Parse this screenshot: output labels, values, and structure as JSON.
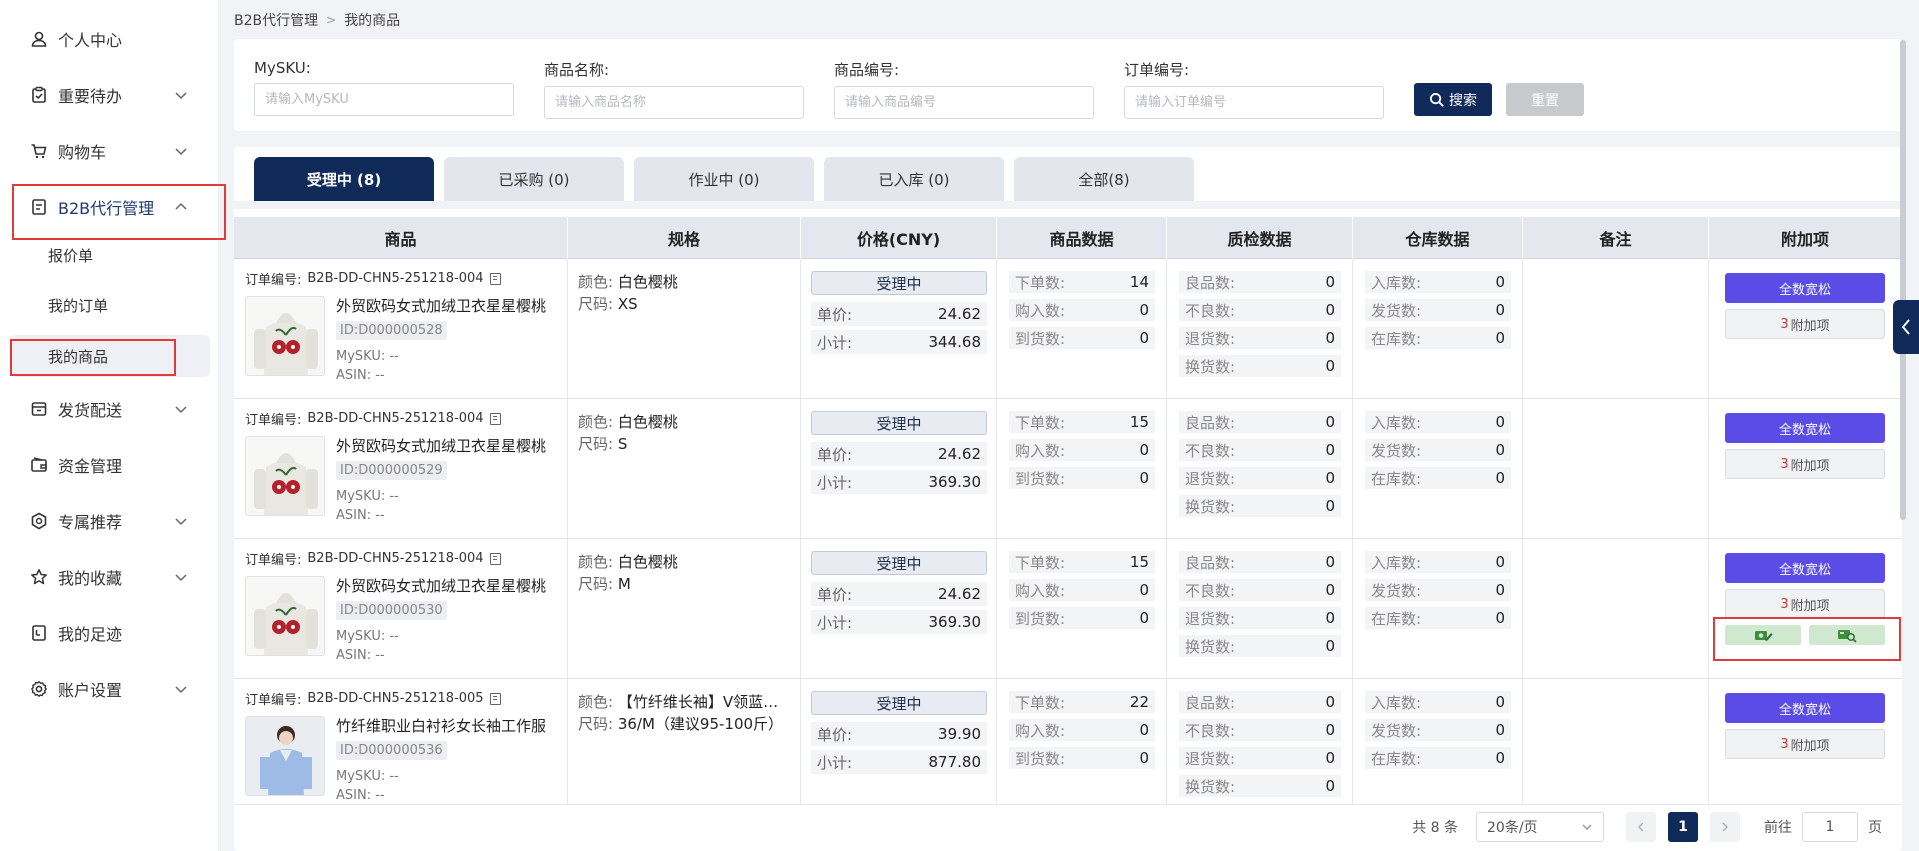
{
  "sidebar": {
    "items": [
      {
        "label": "个人中心",
        "icon": "user-icon",
        "has_chevron": false
      },
      {
        "label": "重要待办",
        "icon": "clipboard-icon",
        "has_chevron": true
      },
      {
        "label": "购物车",
        "icon": "cart-icon",
        "has_chevron": true
      },
      {
        "label": "B2B代行管理",
        "icon": "document-icon",
        "has_chevron": true,
        "expanded": true
      },
      {
        "label": "发货配送",
        "icon": "box-icon",
        "has_chevron": true
      },
      {
        "label": "资金管理",
        "icon": "wallet-icon",
        "has_chevron": false
      },
      {
        "label": "专属推荐",
        "icon": "badge-icon",
        "has_chevron": true
      },
      {
        "label": "我的收藏",
        "icon": "star-icon",
        "has_chevron": true
      },
      {
        "label": "我的足迹",
        "icon": "history-icon",
        "has_chevron": false
      },
      {
        "label": "账户设置",
        "icon": "gear-icon",
        "has_chevron": true
      }
    ],
    "subitems": [
      "报价单",
      "我的订单",
      "我的商品"
    ],
    "selected_subitem": "我的商品"
  },
  "breadcrumb": {
    "parent": "B2B代行管理",
    "current": "我的商品"
  },
  "filters": {
    "sku": {
      "label": "MySKU:",
      "placeholder": "请输入MySKU"
    },
    "name": {
      "label": "商品名称:",
      "placeholder": "请输入商品名称"
    },
    "code": {
      "label": "商品编号:",
      "placeholder": "请输入商品编号"
    },
    "order": {
      "label": "订单编号:",
      "placeholder": "请输入订单编号"
    },
    "search_label": "搜索",
    "reset_label": "重置"
  },
  "tabs": [
    "受理中 (8)",
    "已采购 (0)",
    "作业中 (0)",
    "已入库 (0)",
    "全部(8)"
  ],
  "table": {
    "headers": [
      "商品",
      "规格",
      "价格(CNY)",
      "商品数据",
      "质检数据",
      "仓库数据",
      "备注",
      "附加项"
    ],
    "rows": [
      {
        "order_label": "订单编号:",
        "order_no": "B2B-DD-CHN5-251218-004",
        "name": "外贸欧码女式加绒卫衣星星樱桃",
        "id": "ID:D000000528",
        "mysku": "MySKU: --",
        "asin": "ASIN: --",
        "color_k": "颜色:",
        "color_v": "白色樱桃",
        "size_k": "尺码:",
        "size_v": "XS",
        "status": "受理中",
        "unit_k": "单价:",
        "unit_v": "24.62",
        "sub_k": "小计:",
        "sub_v": "344.68",
        "gd": [
          [
            "下单数:",
            "14"
          ],
          [
            "购入数:",
            "0"
          ],
          [
            "到货数:",
            "0"
          ]
        ],
        "qc": [
          [
            "良品数:",
            "0"
          ],
          [
            "不良数:",
            "0"
          ],
          [
            "退货数:",
            "0"
          ],
          [
            "换货数:",
            "0"
          ]
        ],
        "wh": [
          [
            "入库数:",
            "0"
          ],
          [
            "发货数:",
            "0"
          ],
          [
            "在库数:",
            "0"
          ]
        ],
        "btn": "全数宽松",
        "extra_n": "3",
        "extra_t": "附加项",
        "thumb": "hoodie"
      },
      {
        "order_label": "订单编号:",
        "order_no": "B2B-DD-CHN5-251218-004",
        "name": "外贸欧码女式加绒卫衣星星樱桃",
        "id": "ID:D000000529",
        "mysku": "MySKU: --",
        "asin": "ASIN: --",
        "color_k": "颜色:",
        "color_v": "白色樱桃",
        "size_k": "尺码:",
        "size_v": "S",
        "status": "受理中",
        "unit_k": "单价:",
        "unit_v": "24.62",
        "sub_k": "小计:",
        "sub_v": "369.30",
        "gd": [
          [
            "下单数:",
            "15"
          ],
          [
            "购入数:",
            "0"
          ],
          [
            "到货数:",
            "0"
          ]
        ],
        "qc": [
          [
            "良品数:",
            "0"
          ],
          [
            "不良数:",
            "0"
          ],
          [
            "退货数:",
            "0"
          ],
          [
            "换货数:",
            "0"
          ]
        ],
        "wh": [
          [
            "入库数:",
            "0"
          ],
          [
            "发货数:",
            "0"
          ],
          [
            "在库数:",
            "0"
          ]
        ],
        "btn": "全数宽松",
        "extra_n": "3",
        "extra_t": "附加项",
        "thumb": "hoodie"
      },
      {
        "order_label": "订单编号:",
        "order_no": "B2B-DD-CHN5-251218-004",
        "name": "外贸欧码女式加绒卫衣星星樱桃",
        "id": "ID:D000000530",
        "mysku": "MySKU: --",
        "asin": "ASIN: --",
        "color_k": "颜色:",
        "color_v": "白色樱桃",
        "size_k": "尺码:",
        "size_v": "M",
        "status": "受理中",
        "unit_k": "单价:",
        "unit_v": "24.62",
        "sub_k": "小计:",
        "sub_v": "369.30",
        "gd": [
          [
            "下单数:",
            "15"
          ],
          [
            "购入数:",
            "0"
          ],
          [
            "到货数:",
            "0"
          ]
        ],
        "qc": [
          [
            "良品数:",
            "0"
          ],
          [
            "不良数:",
            "0"
          ],
          [
            "退货数:",
            "0"
          ],
          [
            "换货数:",
            "0"
          ]
        ],
        "wh": [
          [
            "入库数:",
            "0"
          ],
          [
            "发货数:",
            "0"
          ],
          [
            "在库数:",
            "0"
          ]
        ],
        "btn": "全数宽松",
        "extra_n": "3",
        "extra_t": "附加项",
        "thumb": "hoodie",
        "icon_buttons": true
      },
      {
        "order_label": "订单编号:",
        "order_no": "B2B-DD-CHN5-251218-005",
        "name": "竹纤维职业白衬衫女长袖工作服",
        "id": "ID:D000000536",
        "mysku": "MySKU: --",
        "asin": "ASIN: --",
        "color_k": "颜色:",
        "color_v": "【竹纤维长袖】V领蓝色衬衫",
        "size_k": "尺码:",
        "size_v": "36/M（建议95-100斤）",
        "status": "受理中",
        "unit_k": "单价:",
        "unit_v": "39.90",
        "sub_k": "小计:",
        "sub_v": "877.80",
        "gd": [
          [
            "下单数:",
            "22"
          ],
          [
            "购入数:",
            "0"
          ],
          [
            "到货数:",
            "0"
          ]
        ],
        "qc": [
          [
            "良品数:",
            "0"
          ],
          [
            "不良数:",
            "0"
          ],
          [
            "退货数:",
            "0"
          ],
          [
            "换货数:",
            "0"
          ]
        ],
        "wh": [
          [
            "入库数:",
            "0"
          ],
          [
            "发货数:",
            "0"
          ],
          [
            "在库数:",
            "0"
          ]
        ],
        "btn": "全数宽松",
        "extra_n": "3",
        "extra_t": "附加项",
        "thumb": "shirt"
      }
    ]
  },
  "pager": {
    "total": "共 8 条",
    "size": "20条/页",
    "page": "1",
    "goto_label": "前往",
    "goto_value": "1",
    "page_unit": "页"
  },
  "colors": {
    "primary": "#102a5a",
    "accent": "#5b4ce8",
    "highlight": "#e03b3b"
  }
}
